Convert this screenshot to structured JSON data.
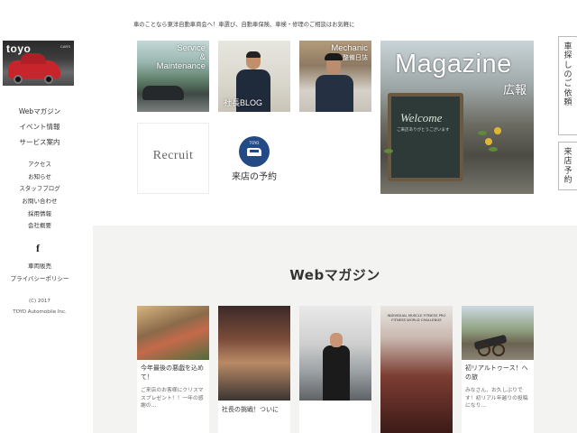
{
  "tagline": "車のことなら東洋自動車商会へ！車選び、自動車保険、車検・修理のご相談はお気軽に",
  "logo": {
    "brand": "toyo",
    "sub": "CARS"
  },
  "nav_main": [
    "Webマガジン",
    "イベント情報",
    "サービス案内"
  ],
  "nav_sub": [
    "アクセス",
    "お知らせ",
    "スタッフブログ",
    "お問い合わせ",
    "採用情報",
    "会社概要"
  ],
  "social": {
    "facebook": "f"
  },
  "nav_foot": [
    "車両販売",
    "プライバシーポリシー"
  ],
  "copyright": {
    "line1": "(C) 2017",
    "line2": "TOYO Automobile Inc."
  },
  "tiles": {
    "service": {
      "line1": "Service",
      "line2": "&",
      "line3": "Maintenance"
    },
    "blog": {
      "label": "社長BLOG"
    },
    "mechanic": {
      "line1": "Mechanic",
      "line2": "整備日誌"
    },
    "recruit": {
      "label": "Recruit"
    },
    "visit": {
      "badge": "TOYO",
      "label": "来店の予約"
    },
    "magazine": {
      "line1": "Magazine",
      "line2": "広報",
      "board_text": "Welcome",
      "board_sub": "ご来店ありがとうございます"
    }
  },
  "side_buttons": {
    "search": [
      "車",
      "探",
      "し",
      "の",
      "ご",
      "依",
      "頼"
    ],
    "visit": [
      "来",
      "店",
      "予",
      "約"
    ]
  },
  "magazine_section": {
    "title": "Webマガジン",
    "cards": [
      {
        "title": "今年最後の悪戯を込めて！",
        "excerpt": "ご来店のお客様にクリスマスプレゼント！！一年の感謝の..."
      },
      {
        "title": "社長の挑戦！ついに",
        "excerpt": ""
      },
      {
        "title": "",
        "excerpt": ""
      },
      {
        "title": "",
        "excerpt": "",
        "poster": "INDIVIDUAL MUSCLE FITNESS\nPRO FITNESS WORLD CHALLENGE"
      },
      {
        "title": "初リアルトゥース！への旅",
        "excerpt": "みなさん、お久しぶりです！初リアル年越りの投稿になり..."
      }
    ]
  },
  "colors": {
    "accent_blue": "#234a84",
    "section_bg": "#f3f3f1"
  }
}
